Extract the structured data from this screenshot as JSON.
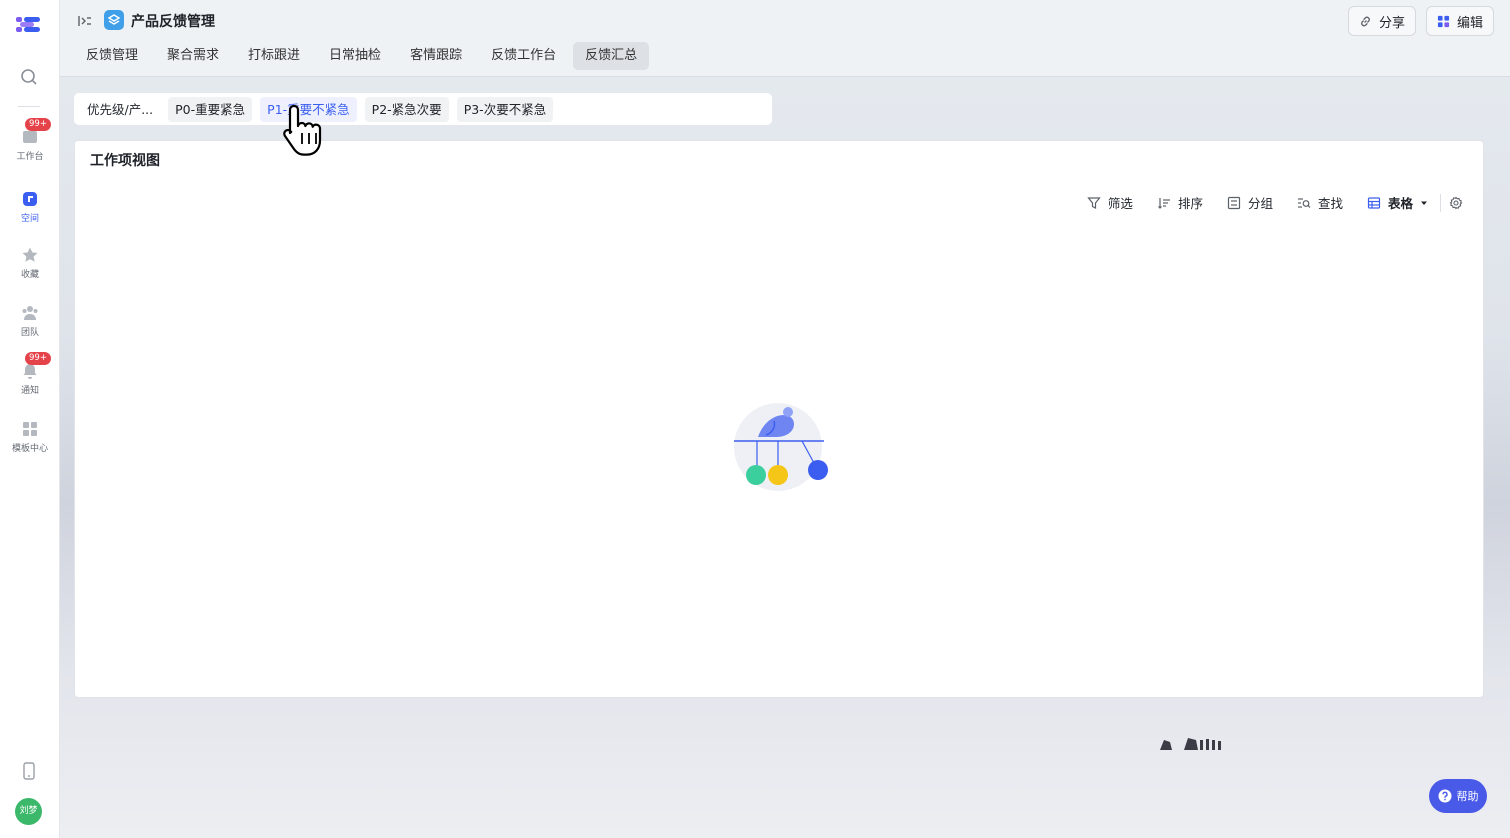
{
  "app": {
    "title": "产品反馈管理",
    "share_label": "分享",
    "edit_label": "编辑"
  },
  "sidebar": {
    "items": [
      {
        "label": "工作台",
        "badge": "99+"
      },
      {
        "label": "空间"
      },
      {
        "label": "收藏"
      },
      {
        "label": "团队"
      },
      {
        "label": "通知",
        "badge": "99+"
      },
      {
        "label": "模板中心"
      }
    ],
    "avatar_text": "刘梦"
  },
  "tabs": [
    {
      "label": "反馈管理"
    },
    {
      "label": "聚合需求"
    },
    {
      "label": "打标跟进"
    },
    {
      "label": "日常抽检"
    },
    {
      "label": "客情跟踪"
    },
    {
      "label": "反馈工作台"
    },
    {
      "label": "反馈汇总",
      "active": true
    }
  ],
  "filters": {
    "group_label": "优先级/产...",
    "chips": [
      {
        "label": "P0-重要紧急"
      },
      {
        "label": "P1-重要不紧急",
        "selected": true
      },
      {
        "label": "P2-紧急次要"
      },
      {
        "label": "P3-次要不紧急"
      }
    ]
  },
  "panel": {
    "title": "工作项视图",
    "toolbar": {
      "filter": "筛选",
      "sort": "排序",
      "group": "分组",
      "find": "查找",
      "view": "表格"
    }
  },
  "help": {
    "label": "帮助"
  },
  "colors": {
    "accent": "#3b5ef0",
    "badge": "#e5434a",
    "help": "#4a5ae8",
    "app_icon": "#3f9fe8"
  }
}
